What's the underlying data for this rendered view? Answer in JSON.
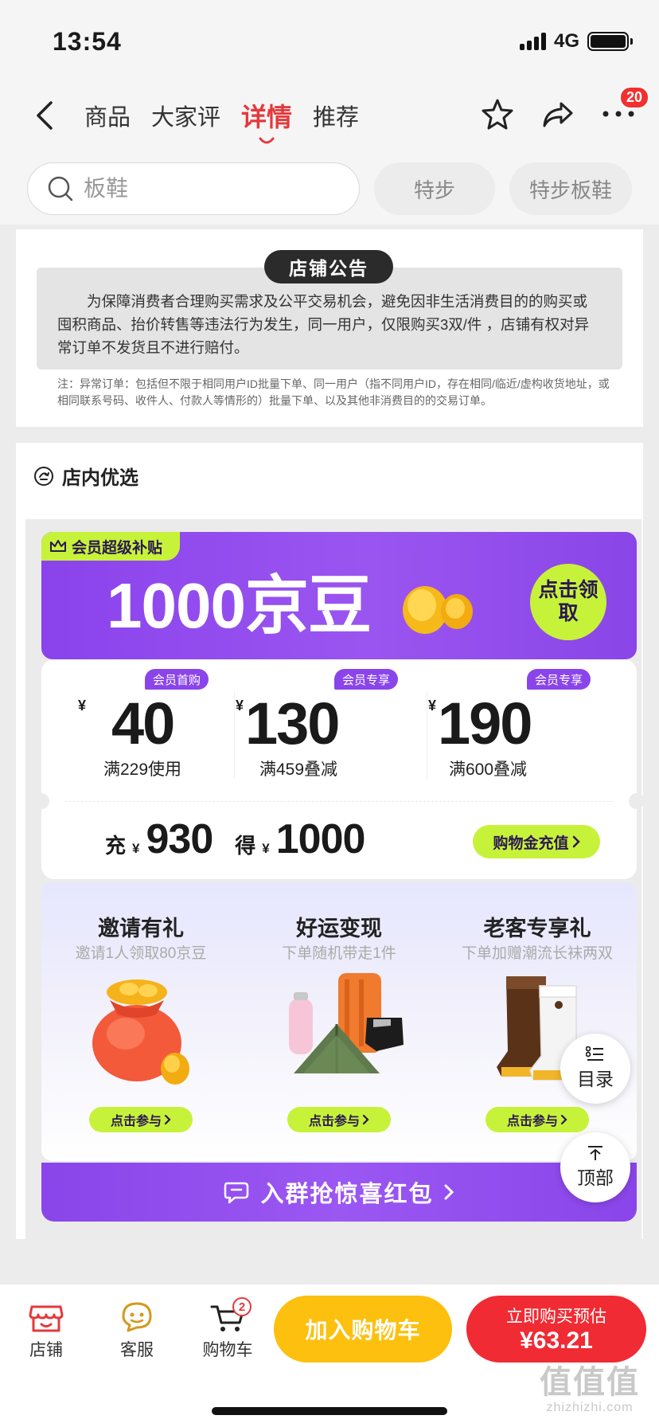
{
  "status": {
    "time": "13:54",
    "network": "4G"
  },
  "nav": {
    "tabs": [
      {
        "label": "商品"
      },
      {
        "label": "大家评"
      },
      {
        "label": "详情"
      },
      {
        "label": "推荐"
      }
    ],
    "more_badge": "20"
  },
  "search": {
    "placeholder": "板鞋",
    "chips": [
      {
        "label": "特步"
      },
      {
        "label": "特步板鞋"
      }
    ]
  },
  "announcement": {
    "title": "店铺公告",
    "body": "为保障消费者合理购买需求及公平交易机会，避免因非生活消费目的的购买或囤积商品、抬价转售等违法行为发生，同一用户，仅限购买3双/件 ，店铺有权对异常订单不发货且不进行赔付。",
    "note": "注：异常订单：包括但不限于相同用户ID批量下单、同一用户（指不同用户ID，存在相同/临近/虚构收货地址，或相同联系号码、收件人、付款人等情形的）批量下单、以及其他非消费目的的交易订单。"
  },
  "store_picks": {
    "title": "店内优选",
    "banner": {
      "tag": "会员超级补贴",
      "amount": "1000京豆",
      "claim_label": "点击领取"
    },
    "coupons": [
      {
        "tag": "会员首购",
        "currency": "¥",
        "value": "40",
        "condition": "满229使用"
      },
      {
        "tag": "会员专享",
        "currency": "¥",
        "value": "130",
        "condition": "满459叠减"
      },
      {
        "tag": "会员专享",
        "currency": "¥",
        "value": "190",
        "condition": "满600叠减"
      }
    ],
    "recharge": {
      "pay_word": "充",
      "pay_currency": "¥",
      "pay_amount": "930",
      "get_word": "得",
      "get_currency": "¥",
      "get_amount": "1000",
      "button_label": "购物金充值"
    },
    "activities": [
      {
        "title": "邀请有礼",
        "subtitle": "邀请1人领取80京豆",
        "button": "点击参与"
      },
      {
        "title": "好运变现",
        "subtitle": "下单随机带走1件",
        "button": "点击参与"
      },
      {
        "title": "老客专享礼",
        "subtitle": "下单加赠潮流长袜两双",
        "button": "点击参与"
      }
    ],
    "group_banner": "入群抢惊喜红包"
  },
  "floating": {
    "catalog": "目录",
    "top": "顶部"
  },
  "bottom_bar": {
    "store": "店铺",
    "service": "客服",
    "cart": "购物车",
    "cart_count": "2",
    "add_to_cart": "加入购物车",
    "buy_label": "立即购买预估",
    "buy_price": "¥63.21"
  },
  "watermark": {
    "main": "值值值",
    "sub": "zhizhizhi.com"
  },
  "colors": {
    "accent_red": "#e4393c",
    "purple": "#8a45ea",
    "lime": "#c7f23a",
    "yellow": "#fdc00f"
  }
}
